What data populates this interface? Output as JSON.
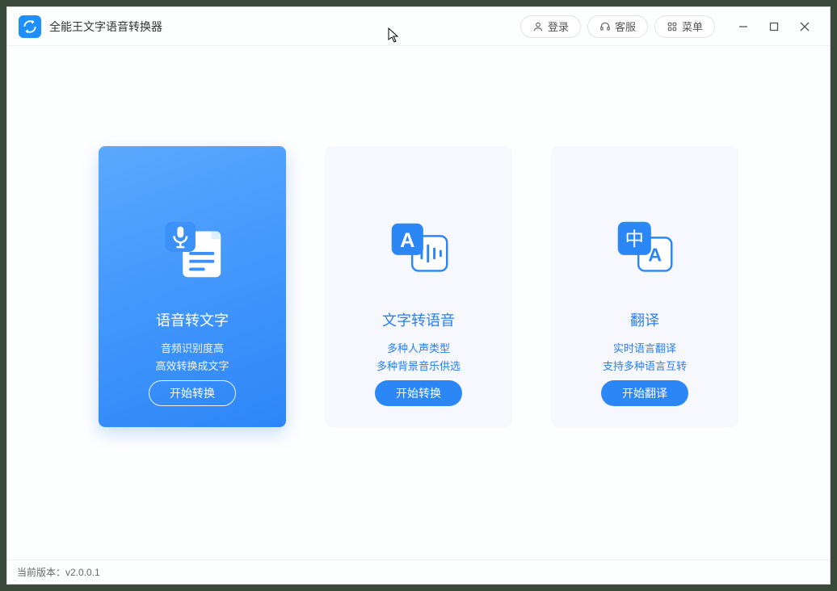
{
  "app": {
    "title": "全能王文字语音转换器"
  },
  "header": {
    "login": "登录",
    "support": "客服",
    "menu": "菜单"
  },
  "cards": [
    {
      "title": "语音转文字",
      "desc1": "音频识别度高",
      "desc2": "高效转换成文字",
      "button": "开始转换"
    },
    {
      "title": "文字转语音",
      "desc1": "多种人声类型",
      "desc2": "多种背景音乐供选",
      "button": "开始转换"
    },
    {
      "title": "翻译",
      "desc1": "实时语言翻译",
      "desc2": "支持多种语言互转",
      "button": "开始翻译"
    }
  ],
  "status": {
    "version_label": "当前版本：",
    "version": "v2.0.0.1"
  }
}
